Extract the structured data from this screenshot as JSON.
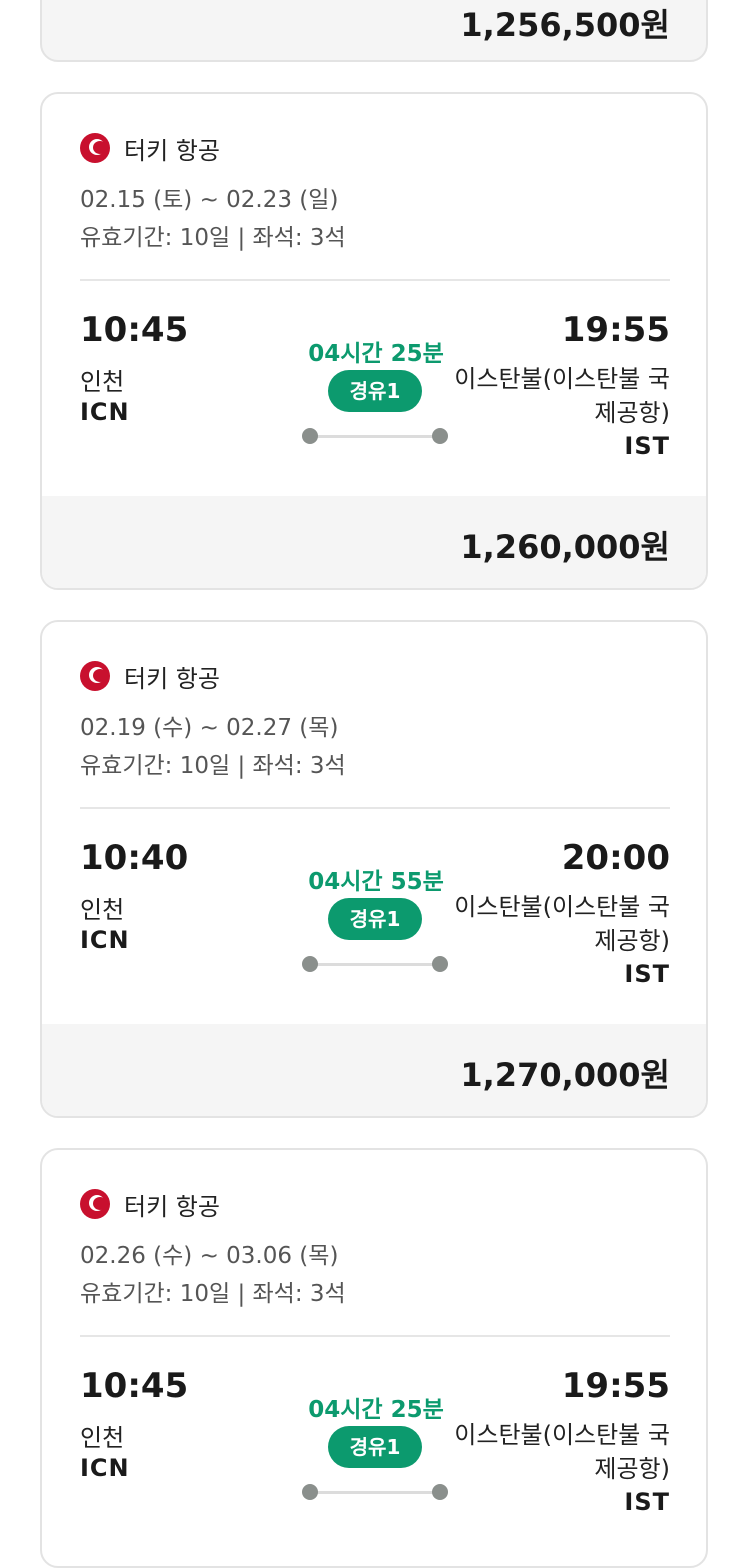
{
  "top_card": {
    "price": "1,256,500원"
  },
  "flights": [
    {
      "airline": "터키 항공",
      "dates": "02.15 (토) ~ 02.23 (일)",
      "validity": "유효기간: 10일 | 좌석: 3석",
      "departure": {
        "time": "10:45",
        "city": "인천",
        "code": "ICN"
      },
      "duration": "04시간 25분",
      "stops": "경유1",
      "arrival": {
        "time": "19:55",
        "city": "이스탄불(이스탄불 국제공항)",
        "code": "IST"
      },
      "price": "1,260,000원"
    },
    {
      "airline": "터키 항공",
      "dates": "02.19 (수) ~ 02.27 (목)",
      "validity": "유효기간: 10일 | 좌석: 3석",
      "departure": {
        "time": "10:40",
        "city": "인천",
        "code": "ICN"
      },
      "duration": "04시간 55분",
      "stops": "경유1",
      "arrival": {
        "time": "20:00",
        "city": "이스탄불(이스탄불 국제공항)",
        "code": "IST"
      },
      "price": "1,270,000원"
    },
    {
      "airline": "터키 항공",
      "dates": "02.26 (수) ~ 03.06 (목)",
      "validity": "유효기간: 10일 | 좌석: 3석",
      "departure": {
        "time": "10:45",
        "city": "인천",
        "code": "ICN"
      },
      "duration": "04시간 25분",
      "stops": "경유1",
      "arrival": {
        "time": "19:55",
        "city": "이스탄불(이스탄불 국제공항)",
        "code": "IST"
      }
    }
  ],
  "colors": {
    "accent": "#0c9a6e",
    "airline_logo": "#c8102e",
    "band": "#f5f5f5"
  },
  "icons": {
    "airline_logo": "turkish-airlines-logo-icon"
  }
}
